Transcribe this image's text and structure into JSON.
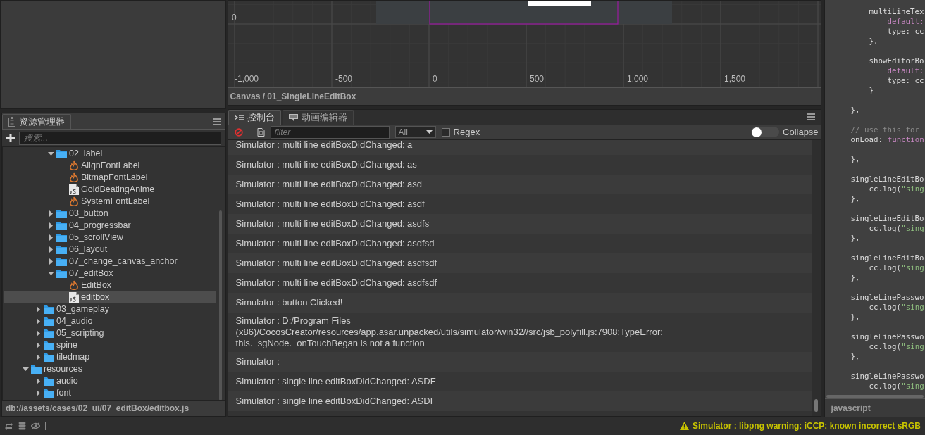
{
  "assets_panel": {
    "tab": "资源管理器",
    "search_placeholder": "搜索...",
    "tree": [
      {
        "children": [
          {
            "children": [
              {
                "label": "02_label",
                "kind": "folder",
                "expanded": true,
                "selected": false,
                "children": [
                  {
                    "label": "AlignFontLabel",
                    "kind": "scene",
                    "selected": false
                  },
                  {
                    "label": "BitmapFontLabel",
                    "kind": "scene",
                    "selected": false
                  },
                  {
                    "label": "GoldBeatingAnime",
                    "kind": "script",
                    "selected": false
                  },
                  {
                    "label": "SystemFontLabel",
                    "kind": "scene",
                    "selected": false
                  }
                ]
              },
              {
                "label": "03_button",
                "kind": "folder",
                "expanded": false,
                "selected": false
              },
              {
                "label": "04_progressbar",
                "kind": "folder",
                "expanded": false,
                "selected": false
              },
              {
                "label": "05_scrollView",
                "kind": "folder",
                "expanded": false,
                "selected": false
              },
              {
                "label": "06_layout",
                "kind": "folder",
                "expanded": false,
                "selected": false
              },
              {
                "label": "07_change_canvas_anchor",
                "kind": "folder",
                "expanded": false,
                "selected": false
              },
              {
                "label": "07_editBox",
                "kind": "folder",
                "expanded": true,
                "selected": false,
                "children": [
                  {
                    "label": "EditBox",
                    "kind": "scene",
                    "selected": false
                  },
                  {
                    "label": "editbox",
                    "kind": "script",
                    "selected": true
                  }
                ]
              }
            ]
          },
          {
            "label": "03_gameplay",
            "kind": "folder",
            "expanded": false,
            "selected": false
          },
          {
            "label": "04_audio",
            "kind": "folder",
            "expanded": false,
            "selected": false
          },
          {
            "label": "05_scripting",
            "kind": "folder",
            "expanded": false,
            "selected": false
          },
          {
            "label": "spine",
            "kind": "folder",
            "expanded": false,
            "selected": false
          },
          {
            "label": "tiledmap",
            "kind": "folder",
            "expanded": false,
            "selected": false
          }
        ]
      },
      {
        "label": "resources",
        "kind": "folder",
        "expanded": true,
        "selected": false,
        "children": [
          {
            "label": "audio",
            "kind": "folder",
            "expanded": false,
            "selected": false
          },
          {
            "label": "font",
            "kind": "folder",
            "expanded": false,
            "selected": false
          }
        ]
      }
    ],
    "path": "db://assets/cases/02_ui/07_editBox/editbox.js"
  },
  "scene": {
    "y_label": "0",
    "x_labels": [
      "-1,000",
      "-500",
      "0",
      "500",
      "1,000",
      "1,500"
    ],
    "breadcrumb": "Canvas / 01_SingleLineEditBox"
  },
  "console": {
    "tabs": [
      {
        "label": "控制台",
        "kind": "console",
        "selected": true
      },
      {
        "label": "动画编辑器",
        "kind": "film",
        "selected": false
      }
    ],
    "filter_placeholder": "filter",
    "level": "All",
    "regex": {
      "label": "Regex",
      "checked": false
    },
    "collapse": {
      "label": "Collapse",
      "on": false
    },
    "logs": [
      "Simulator : multi line editBoxDidChanged: a",
      "Simulator : multi line editBoxDidChanged: as",
      "Simulator : multi line editBoxDidChanged: asd",
      "Simulator : multi line editBoxDidChanged: asdf",
      "Simulator : multi line editBoxDidChanged: asdfs",
      "Simulator : multi line editBoxDidChanged: asdfsd",
      "Simulator : multi line editBoxDidChanged: asdfsdf",
      "Simulator : multi line editBoxDidChanged: asdfsdf",
      "Simulator : button Clicked!",
      "Simulator : D:/Program Files (x86)/CocosCreator/resources/app.asar.unpacked/utils/simulator/win32//src/jsb_polyfill.js:7908:TypeError: this._sgNode._onTouchBegan is not a function",
      "Simulator :",
      "Simulator : single line editBoxDidChanged: ASDF",
      "Simulator : single line editBoxDidChanged: ASDF"
    ]
  },
  "editor": {
    "lines": [
      {
        "kind": "code",
        "tokens": [
          {
            "kind": "plain",
            "text": "        multiLineTex"
          }
        ]
      },
      {
        "kind": "code",
        "tokens": [
          {
            "kind": "keyword",
            "text": "            default:"
          }
        ]
      },
      {
        "kind": "code",
        "tokens": [
          {
            "kind": "plain",
            "text": "            type: cc"
          }
        ]
      },
      {
        "kind": "code",
        "tokens": [
          {
            "kind": "plain",
            "text": "        },"
          }
        ]
      },
      {
        "kind": "blank"
      },
      {
        "kind": "code",
        "tokens": [
          {
            "kind": "plain",
            "text": "        showEditorBo"
          }
        ]
      },
      {
        "kind": "code",
        "tokens": [
          {
            "kind": "keyword",
            "text": "            default:"
          }
        ]
      },
      {
        "kind": "code",
        "tokens": [
          {
            "kind": "plain",
            "text": "            type: cc"
          }
        ]
      },
      {
        "kind": "code",
        "tokens": [
          {
            "kind": "plain",
            "text": "        }"
          }
        ]
      },
      {
        "kind": "blank"
      },
      {
        "kind": "code",
        "tokens": [
          {
            "kind": "plain",
            "text": "    },"
          }
        ]
      },
      {
        "kind": "blank"
      },
      {
        "kind": "code",
        "tokens": [
          {
            "kind": "comment",
            "text": "    // use this for"
          }
        ]
      },
      {
        "kind": "code",
        "tokens": [
          {
            "kind": "plain",
            "text": "    onLoad: "
          },
          {
            "kind": "keyword",
            "text": "function"
          }
        ]
      },
      {
        "kind": "blank"
      },
      {
        "kind": "code",
        "tokens": [
          {
            "kind": "plain",
            "text": "    },"
          }
        ]
      },
      {
        "kind": "blank"
      },
      {
        "kind": "code",
        "tokens": [
          {
            "kind": "plain",
            "text": "    singleLineEditBo"
          }
        ]
      },
      {
        "kind": "code",
        "tokens": [
          {
            "kind": "plain",
            "text": "        cc.log("
          },
          {
            "kind": "string",
            "text": "\"sing"
          }
        ]
      },
      {
        "kind": "code",
        "tokens": [
          {
            "kind": "plain",
            "text": "    },"
          }
        ]
      },
      {
        "kind": "blank"
      },
      {
        "kind": "code",
        "tokens": [
          {
            "kind": "plain",
            "text": "    singleLineEditBo"
          }
        ]
      },
      {
        "kind": "code",
        "tokens": [
          {
            "kind": "plain",
            "text": "        cc.log("
          },
          {
            "kind": "string",
            "text": "\"sing"
          }
        ]
      },
      {
        "kind": "code",
        "tokens": [
          {
            "kind": "plain",
            "text": "    },"
          }
        ]
      },
      {
        "kind": "blank"
      },
      {
        "kind": "code",
        "tokens": [
          {
            "kind": "plain",
            "text": "    singleLineEditBo"
          }
        ]
      },
      {
        "kind": "code",
        "tokens": [
          {
            "kind": "plain",
            "text": "        cc.log("
          },
          {
            "kind": "string",
            "text": "\"sing"
          }
        ]
      },
      {
        "kind": "code",
        "tokens": [
          {
            "kind": "plain",
            "text": "    },"
          }
        ]
      },
      {
        "kind": "blank"
      },
      {
        "kind": "code",
        "tokens": [
          {
            "kind": "plain",
            "text": "    singleLinePasswo"
          }
        ]
      },
      {
        "kind": "code",
        "tokens": [
          {
            "kind": "plain",
            "text": "        cc.log("
          },
          {
            "kind": "string",
            "text": "\"sing"
          }
        ]
      },
      {
        "kind": "code",
        "tokens": [
          {
            "kind": "plain",
            "text": "    },"
          }
        ]
      },
      {
        "kind": "blank"
      },
      {
        "kind": "code",
        "tokens": [
          {
            "kind": "plain",
            "text": "    singleLinePasswo"
          }
        ]
      },
      {
        "kind": "code",
        "tokens": [
          {
            "kind": "plain",
            "text": "        cc.log("
          },
          {
            "kind": "string",
            "text": "\"sing"
          }
        ]
      },
      {
        "kind": "code",
        "tokens": [
          {
            "kind": "plain",
            "text": "    },"
          }
        ]
      },
      {
        "kind": "blank"
      },
      {
        "kind": "code",
        "tokens": [
          {
            "kind": "plain",
            "text": "    singleLinePasswo"
          }
        ]
      },
      {
        "kind": "code",
        "tokens": [
          {
            "kind": "plain",
            "text": "        cc.log("
          },
          {
            "kind": "string",
            "text": "\"sing"
          }
        ]
      }
    ],
    "language": "javascript"
  },
  "status": {
    "kind": "warning",
    "message": "Simulator : libpng warning: iCCP: known incorrect sRGB"
  }
}
